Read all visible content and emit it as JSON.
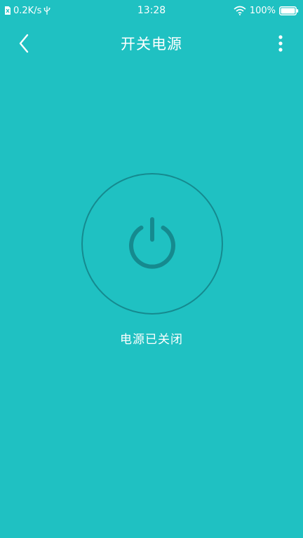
{
  "status_bar": {
    "network_speed": "0.2K/s",
    "time": "13:28",
    "battery_percent": "100%",
    "battery_level": 1.0
  },
  "header": {
    "title": "开关电源"
  },
  "power": {
    "status_text": "电源已关闭",
    "state": "off"
  },
  "colors": {
    "background": "#1fc1c2",
    "accent": "#158a8f",
    "text": "#ffffff"
  }
}
